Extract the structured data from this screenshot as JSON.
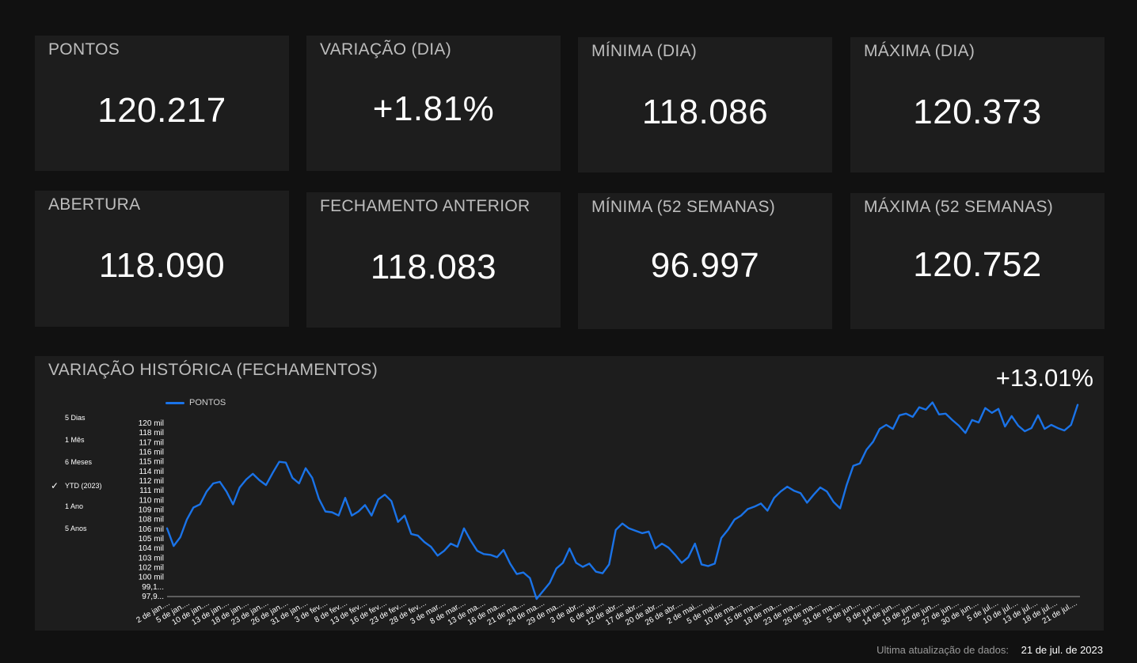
{
  "cards": [
    {
      "title": "PONTOS",
      "value": "120.217"
    },
    {
      "title": "VARIAÇÃO (DIA)",
      "value": "+1.81%"
    },
    {
      "title": "MÍNIMA (DIA)",
      "value": "118.086"
    },
    {
      "title": "MÁXIMA (DIA)",
      "value": "120.373"
    },
    {
      "title": "ABERTURA",
      "value": "118.090"
    },
    {
      "title": "FECHAMENTO ANTERIOR",
      "value": "118.083"
    },
    {
      "title": "MÍNIMA (52 SEMANAS)",
      "value": "96.997"
    },
    {
      "title": "MÁXIMA (52 SEMANAS)",
      "value": "120.752"
    }
  ],
  "chart_panel": {
    "title": "VARIAÇÃO HISTÓRICA (FECHAMENTOS)",
    "change": "+13.01%",
    "ranges": [
      {
        "label": "5 Dias",
        "selected": false
      },
      {
        "label": "1 Mês",
        "selected": false
      },
      {
        "label": "6 Meses",
        "selected": false
      },
      {
        "label": "YTD (2023)",
        "selected": true
      },
      {
        "label": "1 Ano",
        "selected": false
      },
      {
        "label": "5 Anos",
        "selected": false
      }
    ]
  },
  "chart_data": {
    "type": "line",
    "series": [
      {
        "name": "PONTOS",
        "color": "#1a73e8",
        "values": [
          106.4,
          104.2,
          105.3,
          107.5,
          109.0,
          109.4,
          111.0,
          112.0,
          112.2,
          111.0,
          109.4,
          111.5,
          112.5,
          113.2,
          112.4,
          111.8,
          113.3,
          114.7,
          114.6,
          112.7,
          112.0,
          113.9,
          112.7,
          110.1,
          108.5,
          108.4,
          108.0,
          110.2,
          108.0,
          108.5,
          109.3,
          108.0,
          110.0,
          110.6,
          109.8,
          107.2,
          108.0,
          105.7,
          105.5,
          104.7,
          104.1,
          103.0,
          103.6,
          104.5,
          104.1,
          106.4,
          104.9,
          103.6,
          103.2,
          103.1,
          102.8,
          103.7,
          102.0,
          100.7,
          100.9,
          100.2,
          97.6,
          98.6,
          99.6,
          101.4,
          102.1,
          103.9,
          102.1,
          101.6,
          102.0,
          101.0,
          100.8,
          101.9,
          106.2,
          107.0,
          106.4,
          106.1,
          105.8,
          106.0,
          103.9,
          104.5,
          104.0,
          103.1,
          102.1,
          102.8,
          104.5,
          101.9,
          101.7,
          102.0,
          105.2,
          106.2,
          107.5,
          108.0,
          108.8,
          109.1,
          109.5,
          108.6,
          110.2,
          111.0,
          111.6,
          111.1,
          110.8,
          109.6,
          110.6,
          111.5,
          111.0,
          109.7,
          108.9,
          111.8,
          114.2,
          114.5,
          116.2,
          117.2,
          118.8,
          119.3,
          118.8,
          120.5,
          120.7,
          120.3,
          121.5,
          121.2,
          122.1,
          120.6,
          120.7,
          119.9,
          119.2,
          118.3,
          119.9,
          119.6,
          121.4,
          120.8,
          121.3,
          119.1,
          120.4,
          119.2,
          118.5,
          118.9,
          120.5,
          118.8,
          119.3,
          118.9,
          118.6,
          119.3,
          121.8
        ]
      }
    ],
    "x_tick_labels": [
      "2 de jan....",
      "5 de jan....",
      "10 de jan....",
      "13 de jan....",
      "18 de jan....",
      "23 de jan....",
      "26 de jan....",
      "31 de jan....",
      "3 de fev....",
      "8 de fev....",
      "13 de fev....",
      "16 de fev....",
      "23 de fev....",
      "28 de fev....",
      "3 de mar....",
      "8 de mar....",
      "13 de ma....",
      "16 de ma....",
      "21 de ma....",
      "24 de ma....",
      "29 de ma....",
      "3 de abr....",
      "6 de abr....",
      "12 de abr....",
      "17 de abr....",
      "20 de abr....",
      "26 de abr....",
      "2 de mai....",
      "5 de mai....",
      "10 de ma....",
      "15 de ma....",
      "18 de ma....",
      "23 de ma....",
      "26 de ma....",
      "31 de ma....",
      "5 de jun....",
      "9 de jun....",
      "14 de jun....",
      "19 de jun....",
      "22 de jun....",
      "27 de jun....",
      "30 de jun....",
      "5 de jul....",
      "10 de jul....",
      "13 de jul....",
      "18 de jul....",
      "21 de jul...."
    ],
    "y_tick_labels": [
      "97,9...",
      "99,1...",
      "100 mil",
      "102 mil",
      "103 mil",
      "104 mil",
      "105 mil",
      "106 mil",
      "108 mil",
      "109 mil",
      "110 mil",
      "111 mil",
      "112 mil",
      "114 mil",
      "115 mil",
      "116 mil",
      "117 mil",
      "118 mil",
      "120 mil"
    ],
    "y_tick_values": [
      97.9,
      99.1,
      100.3,
      101.5,
      102.7,
      103.9,
      105.1,
      106.3,
      107.5,
      108.7,
      109.9,
      111.1,
      112.3,
      113.5,
      114.7,
      115.9,
      117.1,
      118.3,
      119.5
    ],
    "ylim": [
      97.9,
      119.5
    ],
    "legend_position": "top-left",
    "grid": false
  },
  "footer": {
    "label": "Ultima atualização de dados:",
    "value": "21 de jul. de 2023"
  }
}
